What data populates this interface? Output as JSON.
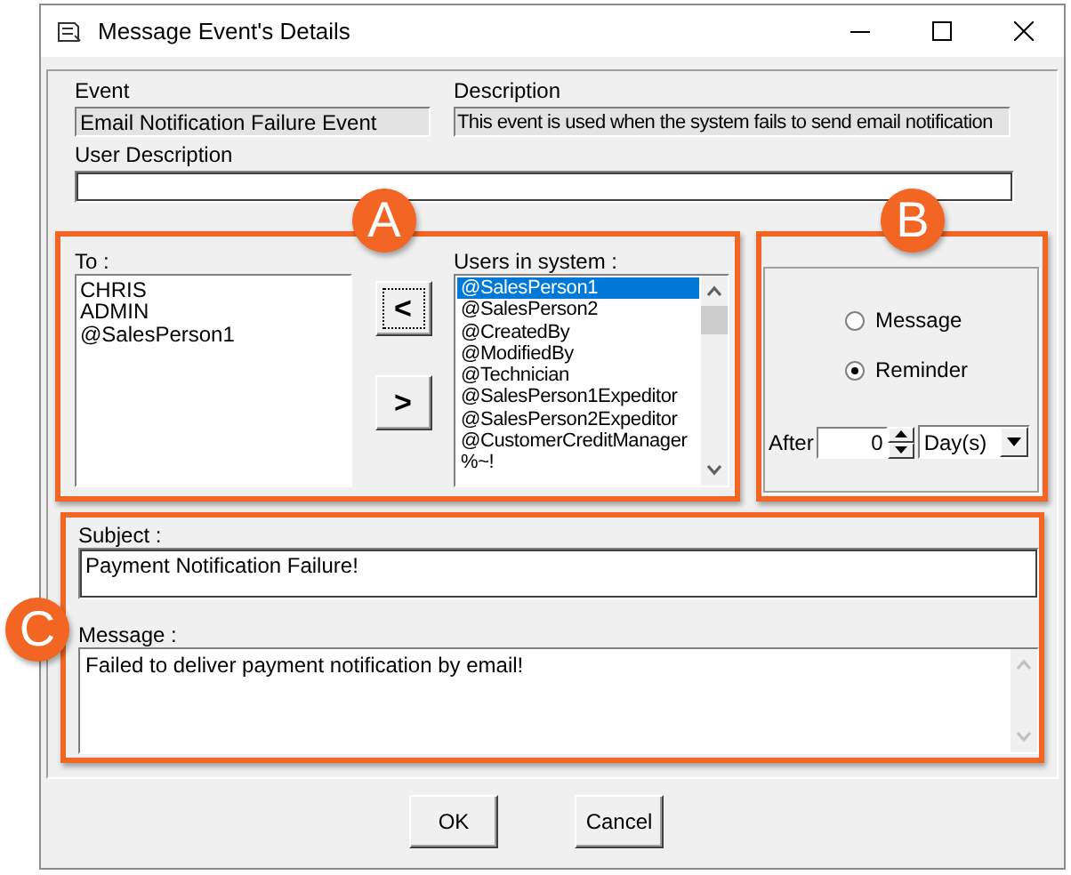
{
  "window": {
    "title": "Message Event's Details"
  },
  "event": {
    "label": "Event",
    "value": "Email Notification Failure Event"
  },
  "description": {
    "label": "Description",
    "value": "This event is used when the system fails to send email notification"
  },
  "user_description": {
    "label": "User Description"
  },
  "recipients": {
    "to_label": "To :",
    "to_items": [
      "CHRIS",
      "ADMIN",
      "@SalesPerson1"
    ],
    "add_button": "<",
    "remove_button": ">",
    "users_label": "Users in system :",
    "users": [
      {
        "text": "@SalesPerson1",
        "selected": true
      },
      {
        "text": "@SalesPerson2",
        "selected": false
      },
      {
        "text": "@CreatedBy",
        "selected": false
      },
      {
        "text": "@ModifiedBy",
        "selected": false
      },
      {
        "text": "@Technician",
        "selected": false
      },
      {
        "text": "@SalesPerson1Expeditor",
        "selected": false
      },
      {
        "text": "@SalesPerson2Expeditor",
        "selected": false
      },
      {
        "text": "@CustomerCreditManager",
        "selected": false
      },
      {
        "text": "%~!",
        "selected": false
      }
    ]
  },
  "type_options": [
    {
      "label": "Message",
      "selected": false
    },
    {
      "label": "Reminder",
      "selected": true
    }
  ],
  "after": {
    "label": "After",
    "value": "0",
    "unit": "Day(s)"
  },
  "subject": {
    "label": "Subject :",
    "value": "Payment Notification Failure!"
  },
  "message": {
    "label": "Message :",
    "value": "Failed to deliver payment notification by email!"
  },
  "buttons": [
    "OK",
    "Cancel"
  ],
  "callouts": [
    "A",
    "B",
    "C"
  ]
}
